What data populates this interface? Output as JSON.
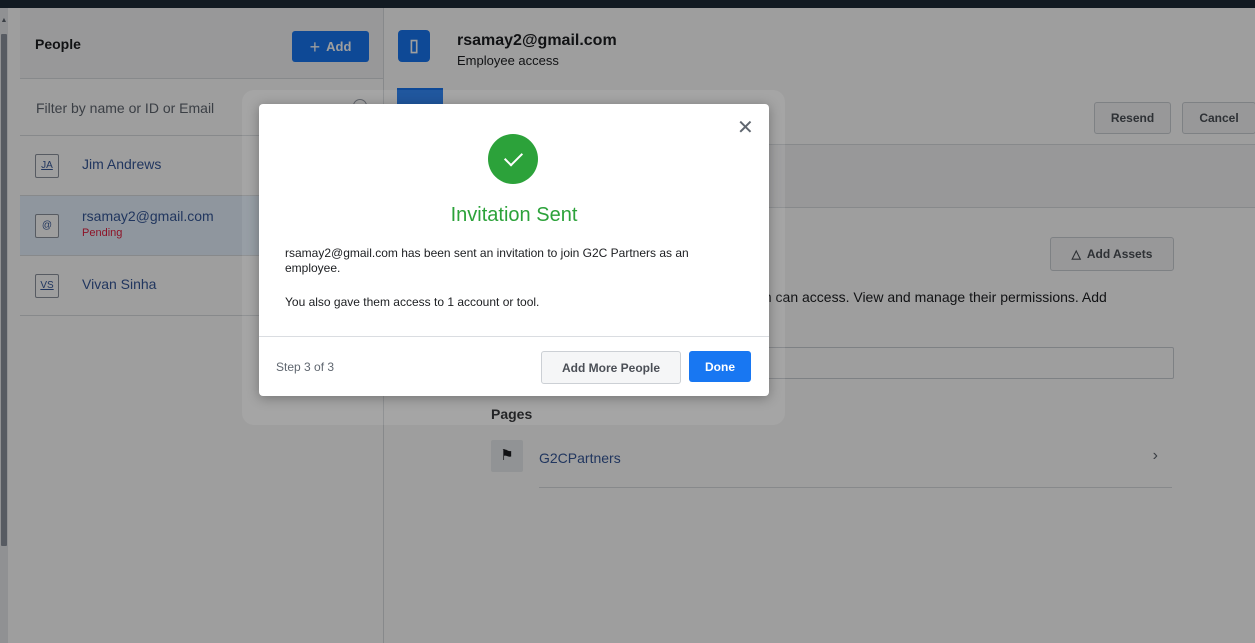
{
  "people_panel": {
    "title": "People",
    "add_button": "Add",
    "filter_placeholder": "Filter by name or ID or Email",
    "people": [
      {
        "initials": "JA",
        "name": "Jim Andrews",
        "status": ""
      },
      {
        "initials": "@",
        "name": "rsamay2@gmail.com",
        "status": "Pending"
      },
      {
        "initials": "VS",
        "name": "Vivan Sinha",
        "status": ""
      }
    ]
  },
  "person_detail": {
    "email": "rsamay2@gmail.com",
    "subtitle": "Employee access",
    "resend_button": "Resend",
    "cancel_button": "Cancel",
    "add_assets_button": "Add Assets",
    "assets_description": "m can access. View and manage their permissions. Add",
    "pages_heading": "Pages",
    "pages": [
      {
        "name": "G2CPartners"
      }
    ]
  },
  "modal": {
    "title": "Invitation Sent",
    "message": "rsamay2@gmail.com has been sent an invitation to join G2C Partners as an employee.",
    "access_message": "You also gave them access to 1 account or tool.",
    "step": "Step 3 of 3",
    "add_more_button": "Add More People",
    "done_button": "Done"
  },
  "colors": {
    "brand_blue": "#1877f2",
    "success_green": "#2ca23a",
    "pending_red": "#e41e3f",
    "link_blue": "#365899"
  },
  "icons": [
    "plus-icon",
    "search-icon",
    "employee-access-icon",
    "add-assets-icon",
    "flag-icon",
    "chevron-right-icon",
    "close-icon",
    "checkmark-icon"
  ]
}
